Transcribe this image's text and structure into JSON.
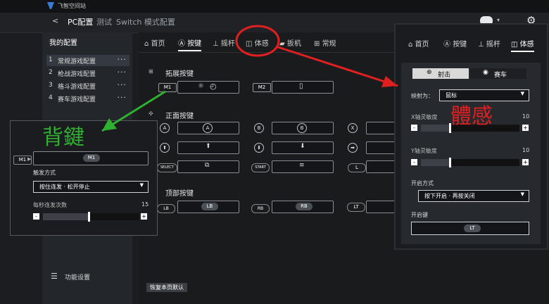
{
  "titlebar": {
    "app_name": "飞智空间站"
  },
  "topbar": {
    "back": "<",
    "tabs": [
      "PC配置",
      "测试",
      "Switch 模式配置"
    ]
  },
  "sidebar": {
    "title": "我的配置",
    "items": [
      {
        "num": "1",
        "label": "常规游戏配置",
        "active": true
      },
      {
        "num": "2",
        "label": "枪战游戏配置"
      },
      {
        "num": "3",
        "label": "格斗游戏配置"
      },
      {
        "num": "4",
        "label": "赛车游戏配置"
      }
    ],
    "dots": "···",
    "footer": "功能设置"
  },
  "main": {
    "tabs": [
      "首页",
      "按键",
      "摇杆",
      "体感",
      "扳机",
      "常规"
    ],
    "sections": {
      "extended": "拓展按键",
      "face": "正面按键",
      "top": "顶部按键"
    },
    "buttons": {
      "m1": "M1",
      "m2": "M2",
      "a": "A",
      "b": "B",
      "x": "X",
      "select": "SELECT",
      "start": "START",
      "l": "L",
      "lb": "LB",
      "rb": "RB",
      "lt": "LT"
    },
    "reset": "恢复本页默认"
  },
  "left_panel": {
    "key": "M1",
    "trigger_label": "触发方式",
    "trigger_value": "按住连发 · 松开停止",
    "rate_label": "每秒连发次数",
    "rate_value": "15",
    "minus": "-",
    "plus": "+"
  },
  "right_panel": {
    "tabs": [
      "首页",
      "按键",
      "摇杆",
      "体感"
    ],
    "mode_a": "射击",
    "mode_b": "赛车",
    "map_label": "映射为：",
    "map_value": "鼠标",
    "x_label": "X轴灵敏度",
    "x_value": "10",
    "y_label": "Y轴灵敏度",
    "y_value": "10",
    "open_mode_label": "开启方式",
    "open_mode_value": "按下开启 · 再按关闭",
    "open_key_label": "开启键",
    "open_key_value": "LT",
    "minus": "-",
    "plus": "+"
  },
  "annotations": {
    "green": "背鍵",
    "red": "體感"
  },
  "colors": {
    "annotation_red": "#e02020",
    "annotation_green": "#30b030",
    "accent": "#ffffff"
  }
}
